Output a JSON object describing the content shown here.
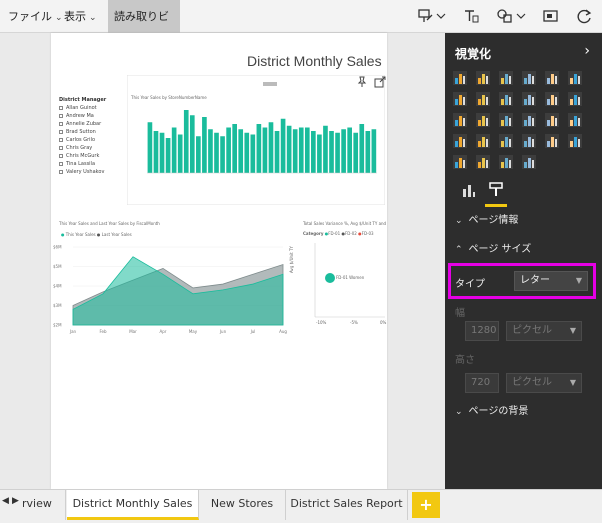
{
  "menubar": {
    "file": "ファイル",
    "view": "表示",
    "reading_view": "読み取りビュー"
  },
  "report": {
    "title": "District Monthly Sales",
    "slicer": {
      "title": "District Manager",
      "items": [
        "Allan Guinot",
        "Andrew Ma",
        "Annelie Zubar",
        "Brad Sutton",
        "Carlos Grilo",
        "Chris Gray",
        "Chris McGurk",
        "Tina Lassila",
        "Valery Ushakov"
      ]
    },
    "bar_chart_title": "This Year Sales by StoreNumberName",
    "area_chart_title": "This Year Sales and Last Year Sales by FiscalMonth",
    "area_legend": [
      "This Year Sales",
      "Last Year Sales"
    ],
    "scatter_title": "Total Sales Variance %, Avg $/Unit TY and This Year Sales by District",
    "scatter_category_label": "Category",
    "scatter_legend": [
      "FD-01",
      "FD-02",
      "FD-03"
    ],
    "scatter_point_label": "FD-01 Women",
    "scatter_ylabel": "Avg $/Unit TY",
    "scatter_xticks": [
      "-10%",
      "-5%",
      "0%"
    ],
    "area_months": [
      "Jan",
      "Feb",
      "Mar",
      "Apr",
      "May",
      "Jun",
      "Jul",
      "Aug"
    ],
    "area_yticks": [
      "$6M",
      "$5M",
      "$4M",
      "$3M",
      "$2M"
    ]
  },
  "pane": {
    "title": "視覚化",
    "sections": {
      "page_info": "ページ情報",
      "page_size": "ページ サイズ",
      "page_background": "ページの背景"
    },
    "type_label": "タイプ",
    "type_value": "レター",
    "width_label": "幅",
    "width_value": "1280",
    "width_unit": "ピクセル",
    "height_label": "高さ",
    "height_value": "720",
    "height_unit": "ピクセル"
  },
  "tabs": [
    "rview",
    "District Monthly Sales",
    "New Stores",
    "District Sales Report"
  ],
  "add_tab": "+",
  "colors": {
    "accent": "#f2c811",
    "teal": "#1abc9c",
    "gray": "#7f8c8d",
    "highlight": "#e600e6",
    "pane_bg": "#2d2d2d"
  },
  "chart_data": [
    {
      "type": "bar",
      "title": "This Year Sales by StoreNumberName",
      "values": [
        2.9,
        2.4,
        2.3,
        2.0,
        2.6,
        2.2,
        3.6,
        3.3,
        2.1,
        3.2,
        2.5,
        2.3,
        2.1,
        2.6,
        2.8,
        2.5,
        2.3,
        2.2,
        2.8,
        2.6,
        2.9,
        2.4,
        3.1,
        2.7,
        2.5,
        2.6,
        2.6,
        2.4,
        2.2,
        2.7,
        2.4,
        2.3,
        2.5,
        2.6,
        2.3,
        2.8,
        2.4,
        2.5
      ]
    },
    {
      "type": "area",
      "title": "This Year Sales and Last Year Sales by FiscalMonth",
      "categories": [
        "Jan",
        "Feb",
        "Mar",
        "Apr",
        "May",
        "Jun",
        "Jul",
        "Aug"
      ],
      "series": [
        {
          "name": "This Year Sales",
          "values": [
            2.8,
            3.6,
            5.5,
            4.6,
            3.6,
            3.8,
            4.1,
            4.6
          ]
        },
        {
          "name": "Last Year Sales",
          "values": [
            3.0,
            3.7,
            4.3,
            4.9,
            3.9,
            4.1,
            4.6,
            5.1
          ]
        }
      ],
      "ylim": [
        2,
        6
      ]
    }
  ]
}
